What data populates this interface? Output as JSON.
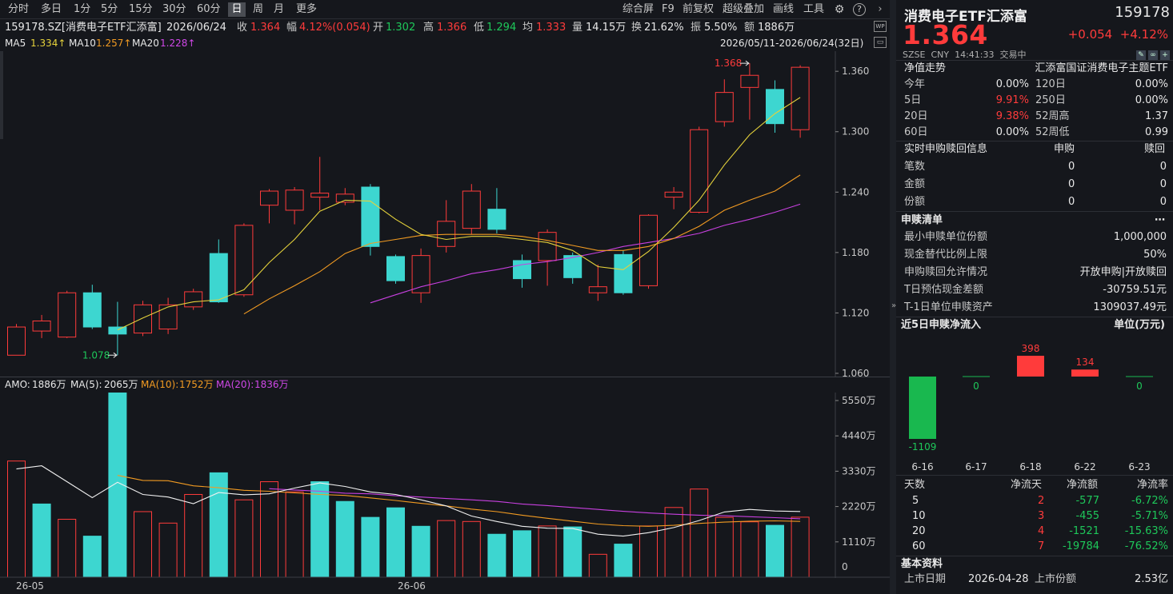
{
  "toolbar": {
    "periods": [
      "分时",
      "多日",
      "1分",
      "5分",
      "15分",
      "30分",
      "60分",
      "日",
      "周",
      "月",
      "更多"
    ],
    "active_period": "日",
    "tools": [
      "综合屏",
      "F9",
      "前复权",
      "超级叠加",
      "画线",
      "工具"
    ],
    "gear_icon": "gear-icon",
    "help_icon": "help-icon",
    "collapse_icon": "chevron-right-icon"
  },
  "info": {
    "title": "159178.SZ[消费电子ETF汇添富]",
    "date": "2026/06/24",
    "close_label": "收",
    "close": "1.364",
    "amp_label": "幅",
    "amp": "4.12%(0.054)",
    "open_label": "开",
    "open": "1.302",
    "high_label": "高",
    "high": "1.366",
    "low_label": "低",
    "low": "1.294",
    "avg_label": "均",
    "avg": "1.333",
    "vol_label": "量",
    "vol": "14.15万",
    "turn_label": "换",
    "turn": "21.62%",
    "swing_label": "振",
    "swing": "5.50%",
    "amt_label": "额",
    "amt": "1886万"
  },
  "ma": {
    "ma5_label": "MA5",
    "ma5": "1.334↑",
    "ma10_label": "MA10",
    "ma10": "1.257↑",
    "ma20_label": "MA20",
    "ma20": "1.228↑",
    "range": "2026/05/11-2026/06/24(32日)"
  },
  "vol_header": {
    "amo_label": "AMO:",
    "amo": "1886万",
    "ma5_label": "MA(5):",
    "ma5": "2065万",
    "ma10_label": "MA(10):",
    "ma10": "1752万",
    "ma20_label": "MA(20):",
    "ma20": "1836万"
  },
  "chart_data": [
    {
      "type": "candlestick",
      "title": "",
      "price_axis": [
        1.06,
        1.12,
        1.18,
        1.24,
        1.3,
        1.36
      ],
      "ylim": [
        1.056,
        1.38
      ],
      "candles": [
        {
          "o": 1.078,
          "c": 1.106,
          "h": 1.109,
          "l": 1.078
        },
        {
          "o": 1.102,
          "c": 1.112,
          "h": 1.118,
          "l": 1.095
        },
        {
          "o": 1.096,
          "c": 1.14,
          "h": 1.142,
          "l": 1.095
        },
        {
          "o": 1.14,
          "c": 1.106,
          "h": 1.148,
          "l": 1.104
        },
        {
          "o": 1.106,
          "c": 1.099,
          "h": 1.131,
          "l": 1.078
        },
        {
          "o": 1.1,
          "c": 1.128,
          "h": 1.132,
          "l": 1.097
        },
        {
          "o": 1.104,
          "c": 1.128,
          "h": 1.135,
          "l": 1.099
        },
        {
          "o": 1.126,
          "c": 1.141,
          "h": 1.144,
          "l": 1.123
        },
        {
          "o": 1.179,
          "c": 1.131,
          "h": 1.193,
          "l": 1.13
        },
        {
          "o": 1.138,
          "c": 1.207,
          "h": 1.209,
          "l": 1.136
        },
        {
          "o": 1.227,
          "c": 1.241,
          "h": 1.243,
          "l": 1.209
        },
        {
          "o": 1.222,
          "c": 1.242,
          "h": 1.245,
          "l": 1.208
        },
        {
          "o": 1.235,
          "c": 1.239,
          "h": 1.275,
          "l": 1.222
        },
        {
          "o": 1.23,
          "c": 1.238,
          "h": 1.244,
          "l": 1.227
        },
        {
          "o": 1.245,
          "c": 1.186,
          "h": 1.248,
          "l": 1.177
        },
        {
          "o": 1.176,
          "c": 1.152,
          "h": 1.178,
          "l": 1.149
        },
        {
          "o": 1.14,
          "c": 1.177,
          "h": 1.184,
          "l": 1.13
        },
        {
          "o": 1.186,
          "c": 1.211,
          "h": 1.232,
          "l": 1.18
        },
        {
          "o": 1.204,
          "c": 1.241,
          "h": 1.248,
          "l": 1.198
        },
        {
          "o": 1.223,
          "c": 1.203,
          "h": 1.244,
          "l": 1.199
        },
        {
          "o": 1.172,
          "c": 1.154,
          "h": 1.178,
          "l": 1.145
        },
        {
          "o": 1.172,
          "c": 1.2,
          "h": 1.203,
          "l": 1.147
        },
        {
          "o": 1.177,
          "c": 1.155,
          "h": 1.18,
          "l": 1.149
        },
        {
          "o": 1.14,
          "c": 1.146,
          "h": 1.168,
          "l": 1.132
        },
        {
          "o": 1.178,
          "c": 1.14,
          "h": 1.182,
          "l": 1.138
        },
        {
          "o": 1.147,
          "c": 1.217,
          "h": 1.218,
          "l": 1.144
        },
        {
          "o": 1.235,
          "c": 1.24,
          "h": 1.245,
          "l": 1.223
        },
        {
          "o": 1.22,
          "c": 1.302,
          "h": 1.305,
          "l": 1.219
        },
        {
          "o": 1.31,
          "c": 1.339,
          "h": 1.352,
          "l": 1.305
        },
        {
          "o": 1.344,
          "c": 1.356,
          "h": 1.368,
          "l": 1.312
        },
        {
          "o": 1.342,
          "c": 1.308,
          "h": 1.351,
          "l": 1.299
        },
        {
          "o": 1.302,
          "c": 1.364,
          "h": 1.366,
          "l": 1.294
        }
      ],
      "ma5": [
        null,
        null,
        null,
        null,
        1.103,
        1.115,
        1.126,
        1.131,
        1.133,
        1.143,
        1.17,
        1.193,
        1.221,
        1.232,
        1.231,
        1.213,
        1.198,
        1.193,
        1.196,
        1.196,
        1.193,
        1.19,
        1.182,
        1.166,
        1.163,
        1.181,
        1.205,
        1.232,
        1.267,
        1.297,
        1.318,
        1.334
      ],
      "ma10": [
        null,
        null,
        null,
        null,
        null,
        null,
        null,
        null,
        null,
        1.119,
        1.134,
        1.147,
        1.161,
        1.179,
        1.189,
        1.193,
        1.197,
        1.198,
        1.198,
        1.198,
        1.196,
        1.192,
        1.187,
        1.182,
        1.182,
        1.186,
        1.194,
        1.206,
        1.222,
        1.232,
        1.241,
        1.257
      ],
      "ma20": [
        null,
        null,
        null,
        null,
        null,
        null,
        null,
        null,
        null,
        null,
        null,
        null,
        null,
        null,
        1.13,
        1.138,
        1.146,
        1.152,
        1.159,
        1.163,
        1.168,
        1.171,
        1.175,
        1.18,
        1.186,
        1.19,
        1.194,
        1.199,
        1.207,
        1.213,
        1.22,
        1.228
      ],
      "markers": {
        "high_label": "1.368",
        "high_index": 29,
        "low_label": "1.078",
        "low_index": 4
      }
    },
    {
      "type": "bar",
      "title": "",
      "unit": "万",
      "axis": [
        0,
        1110,
        2220,
        3330,
        4440,
        5550
      ],
      "axis_labels": [
        "0",
        "1110万",
        "2220万",
        "3330万",
        "4440万",
        "5550万"
      ],
      "values": [
        3650,
        2300,
        1820,
        1290,
        5900,
        2060,
        1700,
        2600,
        3280,
        2430,
        3000,
        2680,
        3000,
        2380,
        1880,
        2180,
        1600,
        1780,
        1750,
        1350,
        1460,
        1610,
        1580,
        720,
        1040,
        1610,
        2190,
        2770,
        1880,
        1740,
        1630,
        1886
      ],
      "up": [
        true,
        false,
        true,
        false,
        false,
        true,
        true,
        true,
        false,
        true,
        true,
        true,
        false,
        false,
        false,
        false,
        false,
        true,
        true,
        false,
        false,
        true,
        false,
        true,
        false,
        true,
        true,
        true,
        true,
        true,
        false,
        true
      ],
      "ma5": [
        3400,
        3500,
        3000,
        2500,
        2980,
        2600,
        2520,
        2310,
        2660,
        2590,
        2620,
        2800,
        2960,
        2850,
        2680,
        2600,
        2430,
        2240,
        1920,
        1750,
        1600,
        1540,
        1530,
        1350,
        1290,
        1400,
        1560,
        1780,
        2050,
        2130,
        2080,
        2065
      ],
      "ma10": [
        null,
        null,
        null,
        null,
        3200,
        3040,
        3030,
        2870,
        2810,
        2730,
        2700,
        2650,
        2600,
        2570,
        2490,
        2410,
        2320,
        2240,
        2140,
        2060,
        1950,
        1850,
        1760,
        1670,
        1620,
        1600,
        1630,
        1690,
        1730,
        1760,
        1770,
        1752
      ],
      "ma20": [
        null,
        null,
        null,
        null,
        null,
        null,
        null,
        null,
        null,
        null,
        2780,
        2740,
        2700,
        2640,
        2620,
        2560,
        2520,
        2470,
        2430,
        2380,
        2300,
        2250,
        2190,
        2130,
        2070,
        2020,
        1980,
        1950,
        1930,
        1900,
        1870,
        1836
      ],
      "dates": [
        "26-05",
        "26-06"
      ]
    },
    {
      "type": "bar",
      "title": "近5日申赎净流入",
      "unit": "单位(万元)",
      "categories": [
        "6-16",
        "6-17",
        "6-18",
        "6-22",
        "6-23"
      ],
      "values": [
        -1109,
        0,
        398,
        134,
        0
      ],
      "value_labels": [
        "-1109",
        "0",
        "398",
        "134",
        "0"
      ]
    }
  ],
  "right": {
    "name": "消费电子ETF汇添富",
    "code": "159178",
    "price": "1.364",
    "change": "+0.054",
    "pct": "+4.12%",
    "market": "SZSE",
    "currency": "CNY",
    "time": "14:41:33",
    "status": "交易中",
    "nav_title": "净值走势",
    "nav_index": "汇添富国证消费电子主题ETF",
    "nav": [
      [
        "今年",
        "0.00%",
        "120日",
        "0.00%"
      ],
      [
        "5日",
        "9.91%",
        "250日",
        "0.00%"
      ],
      [
        "20日",
        "9.38%",
        "52周高",
        "1.37"
      ],
      [
        "60日",
        "0.00%",
        "52周低",
        "0.99"
      ]
    ],
    "rt_title": "实时申购赎回信息",
    "rt_col1": "申购",
    "rt_col2": "赎回",
    "rt": [
      [
        "笔数",
        "0",
        "0"
      ],
      [
        "金额",
        "0",
        "0"
      ],
      [
        "份额",
        "0",
        "0"
      ]
    ],
    "list_title": "申赎清单",
    "list_more": "⋯",
    "list": [
      [
        "最小申赎单位份额",
        "1,000,000"
      ],
      [
        "现金替代比例上限",
        "50%"
      ],
      [
        "申购赎回允许情况",
        "开放申购|开放赎回"
      ],
      [
        "T日预估现金差额",
        "-30759.51元"
      ],
      [
        "T-1日单位申赎资产",
        "1309037.49元"
      ]
    ],
    "flow_title": "近5日申赎净流入",
    "flow_unit": "单位(万元)",
    "stats_header": [
      "天数",
      "净流天",
      "净流额",
      "净流率"
    ],
    "stats": [
      [
        "5",
        "2",
        "-577",
        "-6.72%"
      ],
      [
        "10",
        "3",
        "-455",
        "-5.71%"
      ],
      [
        "20",
        "4",
        "-1521",
        "-15.63%"
      ],
      [
        "60",
        "7",
        "-19784",
        "-76.52%"
      ]
    ],
    "basic_title": "基本资料",
    "basic_listing_label": "上市日期",
    "basic_listing": "2026-04-28",
    "basic_shares_label": "上市份额",
    "basic_shares": "2.53亿",
    "side_arrow": "»"
  }
}
